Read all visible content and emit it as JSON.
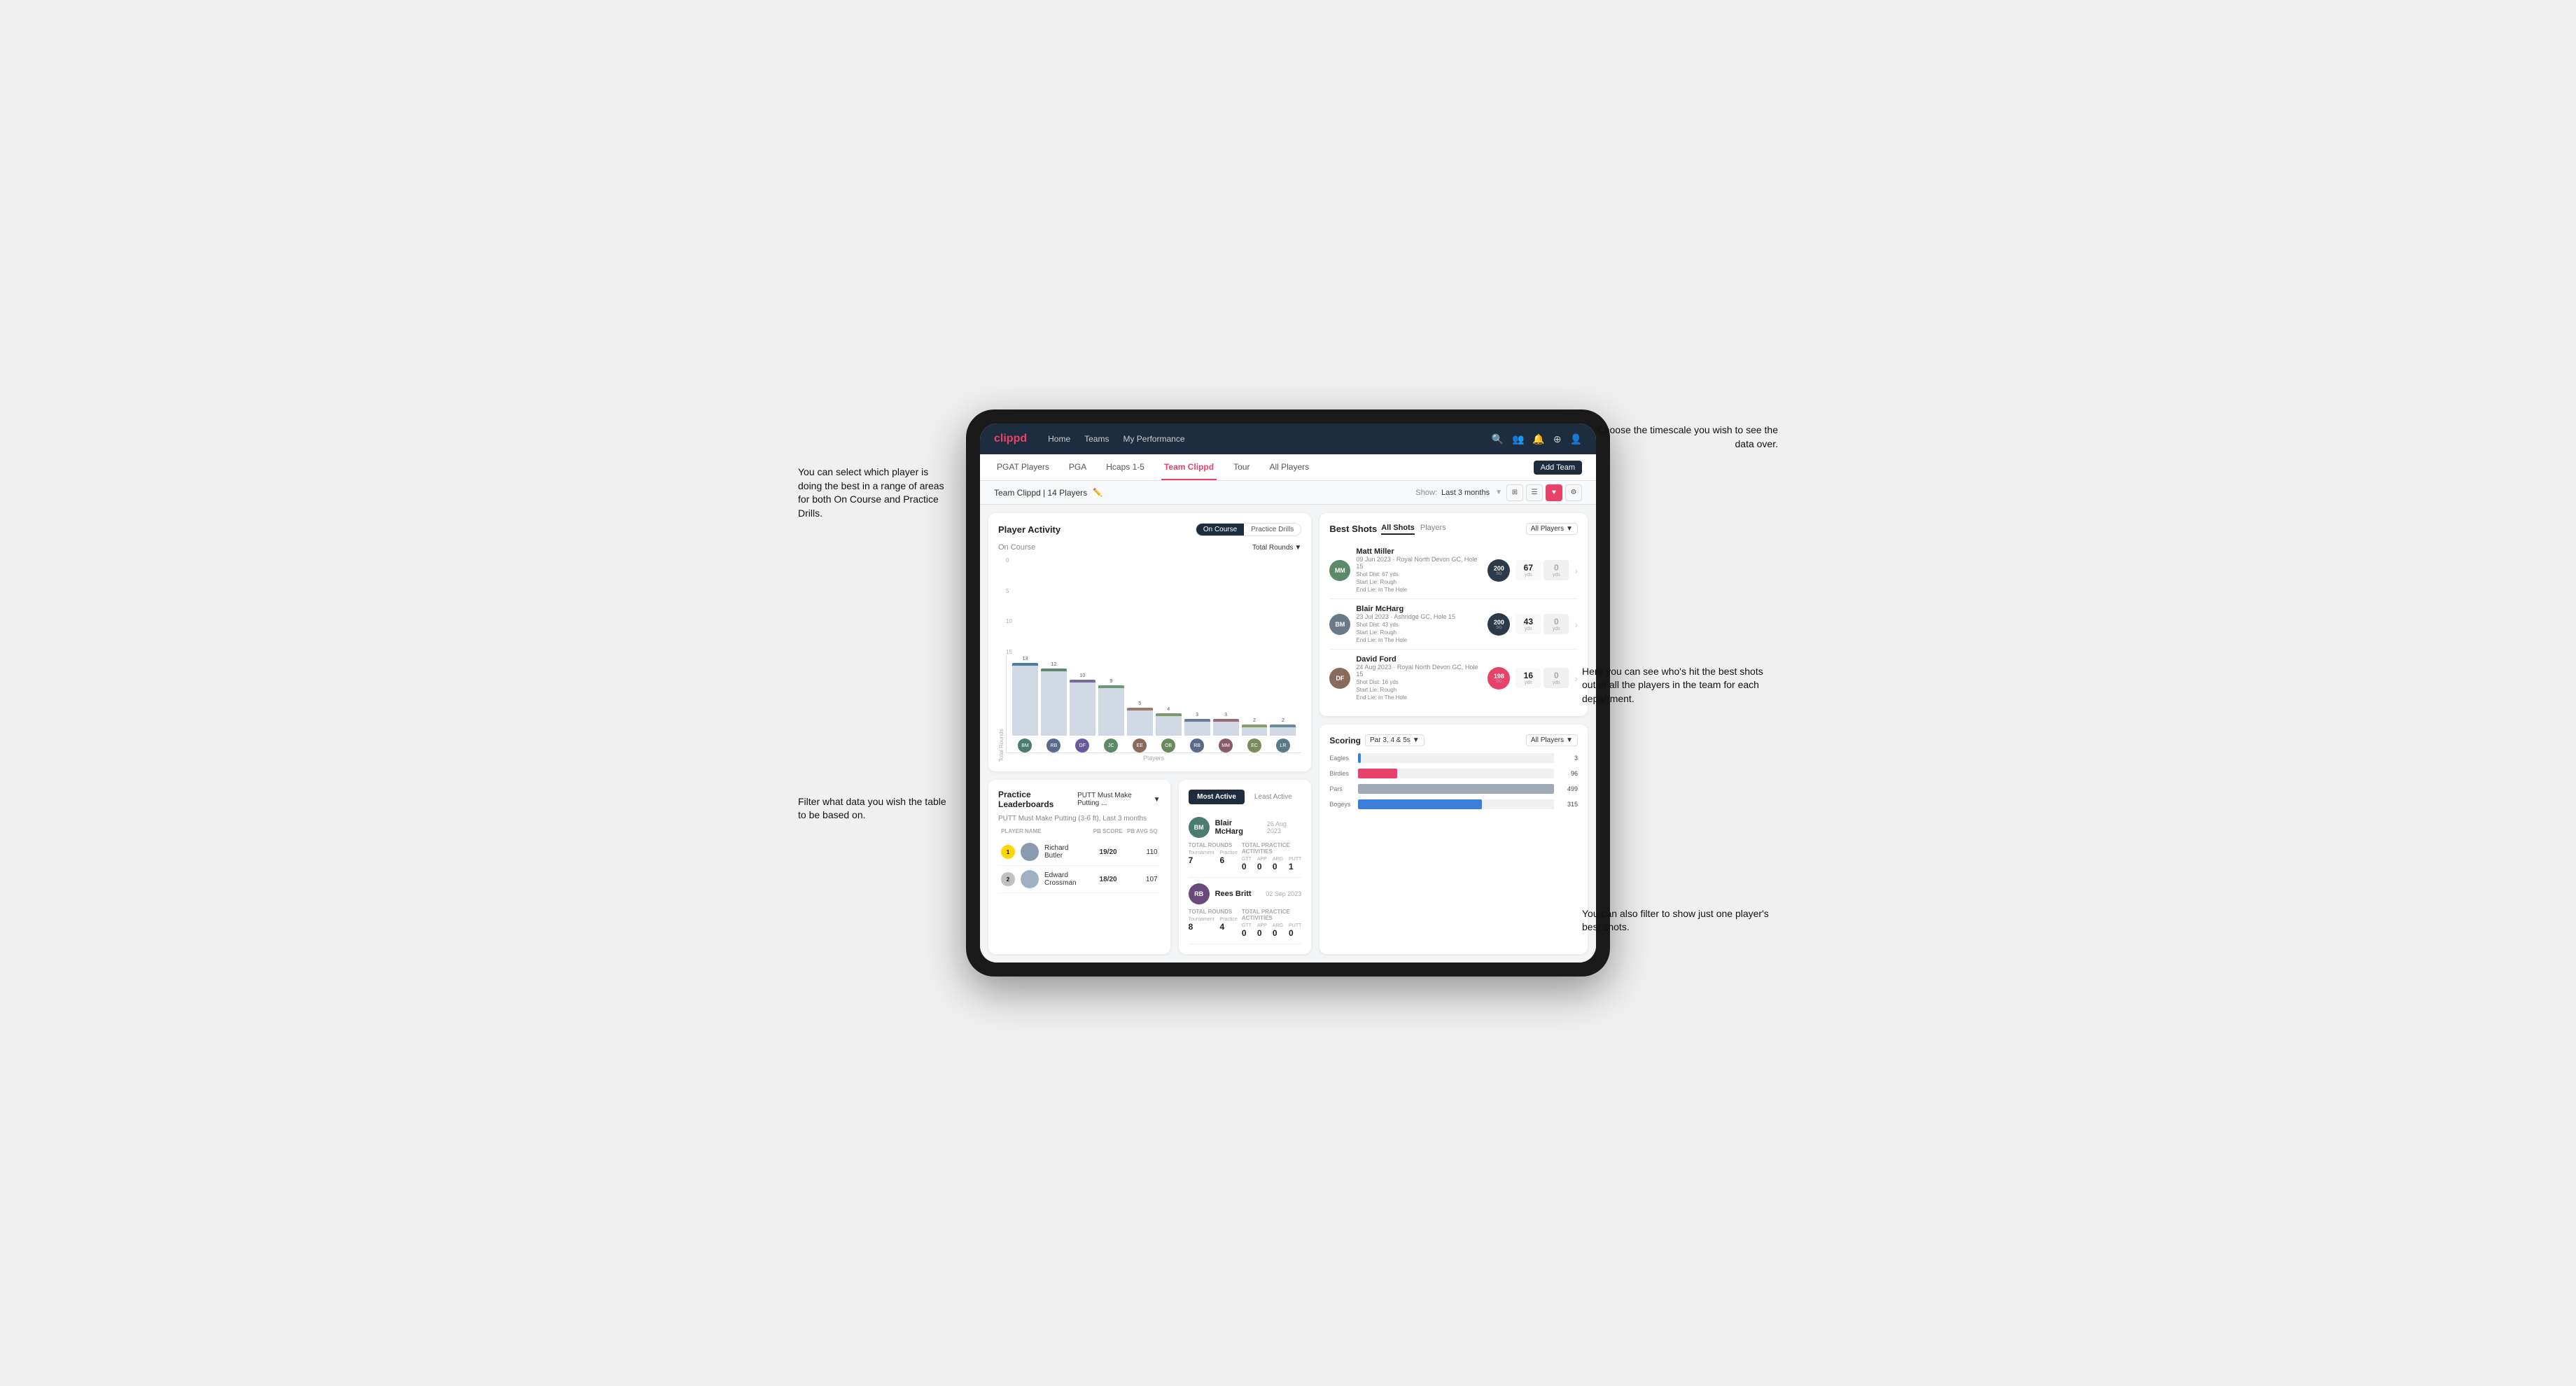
{
  "annotations": {
    "top_left": "You can select which player is doing the best in a range of areas for both On Course and Practice Drills.",
    "top_right": "Choose the timescale you wish to see the data over.",
    "bottom_left": "Filter what data you wish the table to be based on.",
    "mid_right": "Here you can see who's hit the best shots out of all the players in the team for each department.",
    "bot_right": "You can also filter to show just one player's best shots."
  },
  "nav": {
    "logo": "clippd",
    "links": [
      "Home",
      "Teams",
      "My Performance"
    ],
    "icons": [
      "search",
      "users",
      "bell",
      "plus",
      "user"
    ]
  },
  "sub_nav": {
    "items": [
      "PGAT Players",
      "PGA",
      "Hcaps 1-5",
      "Team Clippd",
      "Tour",
      "All Players"
    ],
    "active": "Team Clippd",
    "add_button": "Add Team"
  },
  "team_header": {
    "title": "Team Clippd | 14 Players",
    "show_label": "Show:",
    "time_filter": "Last 3 months",
    "views": [
      "grid",
      "list",
      "heart",
      "settings"
    ]
  },
  "player_activity": {
    "title": "Player Activity",
    "toggle": [
      "On Course",
      "Practice Drills"
    ],
    "active_toggle": "On Course",
    "chart_subtitle": "On Course",
    "chart_filter": "Total Rounds",
    "y_labels": [
      "15",
      "10",
      "5",
      "0"
    ],
    "x_label": "Players",
    "bars": [
      {
        "name": "B. McHarg",
        "value": 13,
        "height": 87
      },
      {
        "name": "R. Britt",
        "value": 12,
        "height": 80
      },
      {
        "name": "D. Ford",
        "value": 10,
        "height": 67
      },
      {
        "name": "J. Coles",
        "value": 9,
        "height": 60
      },
      {
        "name": "E. Ebert",
        "value": 5,
        "height": 33
      },
      {
        "name": "O. Billingham",
        "value": 4,
        "height": 27
      },
      {
        "name": "R. Butler",
        "value": 3,
        "height": 20
      },
      {
        "name": "M. Miller",
        "value": 3,
        "height": 20
      },
      {
        "name": "E. Crossman",
        "value": 2,
        "height": 13
      },
      {
        "name": "L. Robertson",
        "value": 2,
        "height": 13
      }
    ]
  },
  "best_shots": {
    "title": "Best Shots",
    "tabs": [
      "All Shots",
      "Players"
    ],
    "active_tab": "All Shots",
    "filter": "All Players",
    "players": [
      {
        "name": "Matt Miller",
        "date": "09 Jun 2023",
        "course": "Royal North Devon GC",
        "hole": "Hole 15",
        "badge": "200",
        "badge_label": "SG",
        "shot_dist": "Shot Dist: 67 yds",
        "start_lie": "Start Lie: Rough",
        "end_lie": "End Lie: In The Hole",
        "stat1": "67",
        "stat1_unit": "yds",
        "stat2": "0",
        "stat2_unit": "yds"
      },
      {
        "name": "Blair McHarg",
        "date": "23 Jul 2023",
        "course": "Ashridge GC",
        "hole": "Hole 15",
        "badge": "200",
        "badge_label": "SG",
        "shot_dist": "Shot Dist: 43 yds",
        "start_lie": "Start Lie: Rough",
        "end_lie": "End Lie: In The Hole",
        "stat1": "43",
        "stat1_unit": "yds",
        "stat2": "0",
        "stat2_unit": "yds"
      },
      {
        "name": "David Ford",
        "date": "24 Aug 2023",
        "course": "Royal North Devon GC",
        "hole": "Hole 15",
        "badge": "198",
        "badge_label": "SG",
        "shot_dist": "Shot Dist: 16 yds",
        "start_lie": "Start Lie: Rough",
        "end_lie": "End Lie: In The Hole",
        "stat1": "16",
        "stat1_unit": "yds",
        "stat2": "0",
        "stat2_unit": "yds"
      }
    ]
  },
  "practice_leaderboards": {
    "title": "Practice Leaderboards",
    "drill": "PUTT Must Make Putting ...",
    "subtitle": "PUTT Must Make Putting (3-6 ft), Last 3 months",
    "columns": [
      "PLAYER NAME",
      "PB SCORE",
      "PB AVG SQ"
    ],
    "players": [
      {
        "rank": 1,
        "name": "Richard Butler",
        "score": "19/20",
        "avg": "110"
      },
      {
        "rank": 2,
        "name": "Edward Crossman",
        "score": "18/20",
        "avg": "107"
      }
    ]
  },
  "most_active": {
    "tabs": [
      "Most Active",
      "Least Active"
    ],
    "active_tab": "Most Active",
    "players": [
      {
        "name": "Blair McHarg",
        "date": "26 Aug 2023",
        "total_rounds_label": "Total Rounds",
        "tournament": 7,
        "practice": 6,
        "total_practice_label": "Total Practice Activities",
        "gtt": 0,
        "app": 0,
        "arg": 0,
        "putt": 1
      },
      {
        "name": "Rees Britt",
        "date": "02 Sep 2023",
        "total_rounds_label": "Total Rounds",
        "tournament": 8,
        "practice": 4,
        "total_practice_label": "Total Practice Activities",
        "gtt": 0,
        "app": 0,
        "arg": 0,
        "putt": 0
      }
    ]
  },
  "scoring": {
    "title": "Scoring",
    "filter1": "Par 3, 4 & 5s",
    "filter2": "All Players",
    "rows": [
      {
        "label": "Eagles",
        "value": 3,
        "max": 500,
        "color": "#3b7dd8"
      },
      {
        "label": "Birdies",
        "value": 96,
        "max": 500,
        "color": "#e8426a"
      },
      {
        "label": "Pars",
        "value": 499,
        "max": 500,
        "color": "#a0aab4"
      },
      {
        "label": "Bogeys",
        "value": 315,
        "max": 500,
        "color": "#f0a030"
      }
    ]
  }
}
